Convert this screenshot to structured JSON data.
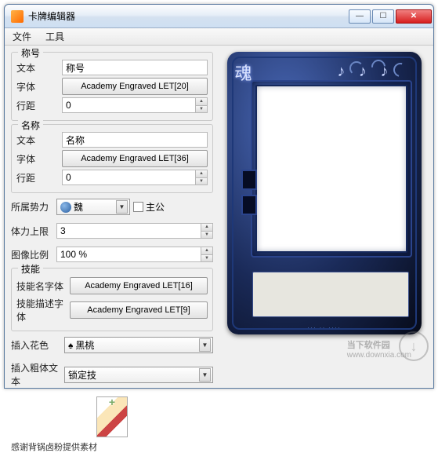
{
  "window": {
    "title": "卡牌编辑器"
  },
  "menu": {
    "file": "文件",
    "tools": "工具"
  },
  "group_title": {
    "legend": "称号",
    "text_label": "文本",
    "text_value": "称号",
    "font_label": "字体",
    "font_button": "Academy Engraved LET[20]",
    "spacing_label": "行距",
    "spacing_value": "0"
  },
  "group_name": {
    "legend": "名称",
    "text_label": "文本",
    "text_value": "名称",
    "font_label": "字体",
    "font_button": "Academy Engraved LET[36]",
    "spacing_label": "行距",
    "spacing_value": "0"
  },
  "faction": {
    "label": "所属势力",
    "value": "魏",
    "lord_label": "主公"
  },
  "hp": {
    "label": "体力上限",
    "value": "3"
  },
  "scale": {
    "label": "图像比例",
    "value": "100 %"
  },
  "skill": {
    "legend": "技能",
    "name_font_label": "技能名字体",
    "name_font_button": "Academy Engraved LET[16]",
    "desc_font_label": "技能描述字体",
    "desc_font_button": "Academy Engraved LET[9]"
  },
  "suit": {
    "label": "插入花色",
    "value": "黑桃",
    "symbol": "♠"
  },
  "bold": {
    "label": "插入粗体文本",
    "value": "锁定技"
  },
  "credit": "感谢背锅卤粉提供素材",
  "card": {
    "dots": "♪ ♪ ♪",
    "footer": "··· ·· ····"
  },
  "watermark": {
    "brand": "当下软件园",
    "url": "www.downxia.com"
  }
}
